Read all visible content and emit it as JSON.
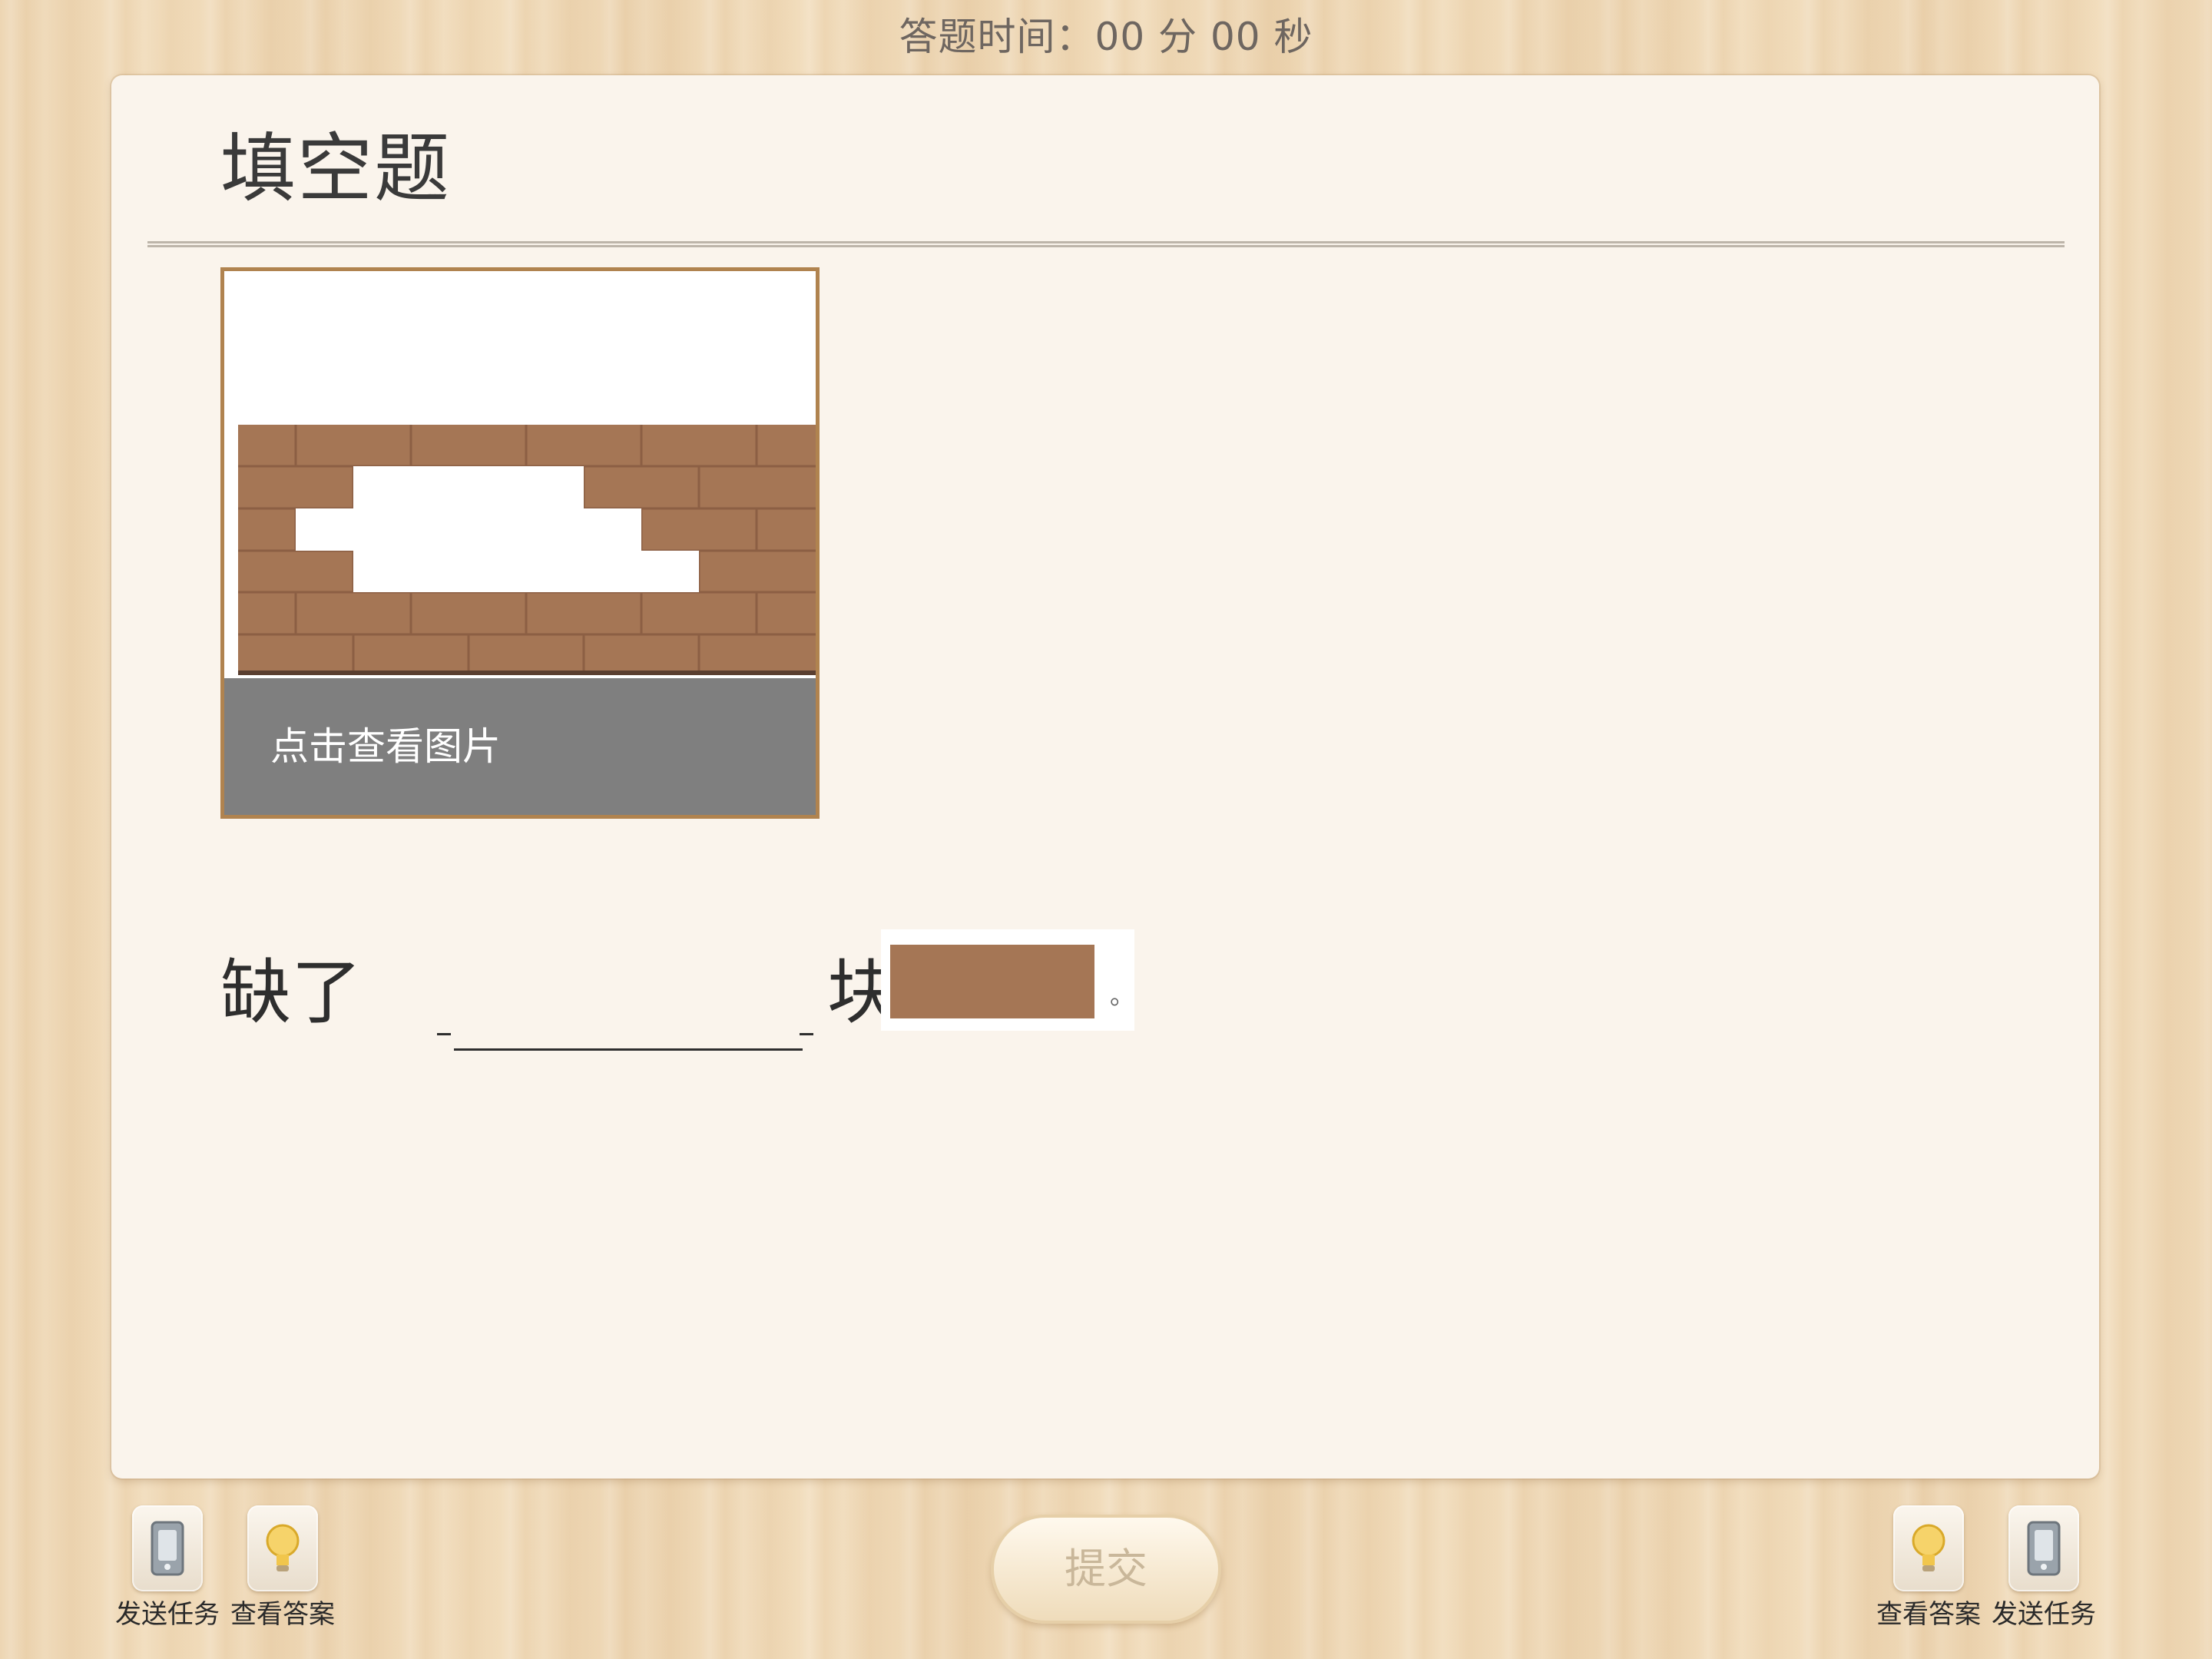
{
  "timer": {
    "text": "答题时间：00 分 00 秒"
  },
  "question": {
    "title": "填空题",
    "image_caption": "点击查看图片",
    "sentence_before": "缺了",
    "sentence_after": "块",
    "period": "。",
    "brick_color": "#a57655"
  },
  "toolbar": {
    "left": [
      {
        "label": "发送任务",
        "icon": "phone-icon"
      },
      {
        "label": "查看答案",
        "icon": "bulb-icon"
      }
    ],
    "right": [
      {
        "label": "查看答案",
        "icon": "bulb-icon"
      },
      {
        "label": "发送任务",
        "icon": "phone-icon"
      }
    ],
    "submit_label": "提交"
  },
  "colors": {
    "background_wood": "#f0dab8",
    "card": "#faf4ec",
    "thumb_border": "#b0834f",
    "caption_bg": "#7f7f7f"
  }
}
